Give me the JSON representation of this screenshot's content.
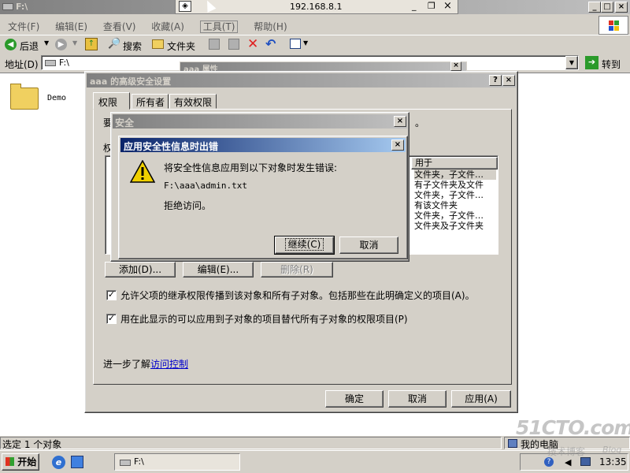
{
  "explorer": {
    "title": "F:\\",
    "menu": [
      "文件(F)",
      "编辑(E)",
      "查看(V)",
      "收藏(A)",
      "工具(T)",
      "帮助(H)"
    ],
    "toolbar": {
      "back": "后退",
      "search": "搜索",
      "folders": "文件夹"
    },
    "address_label": "地址(D)",
    "address_value": "F:\\",
    "go": "转到",
    "folder_item": "Demo",
    "status_left": "选定 1 个对象",
    "status_right": "我的电脑"
  },
  "remote_bar": {
    "host": "192.168.8.1"
  },
  "props_window": {
    "title": "aaa 属性"
  },
  "advanced": {
    "title": "aaa 的高级安全设置",
    "tabs": [
      "权限",
      "所有者",
      "有效权限"
    ],
    "intro_partial": "要",
    "entries_partial": "权",
    "apply_to_header": "用于",
    "apply_to_rows": [
      "文件夹，子文件…",
      "有子文件夹及文件",
      "文件夹，子文件…",
      "有该文件夹",
      "文件夹，子文件…",
      "文件夹及子文件夹"
    ],
    "add": "添加(D)...",
    "edit": "编辑(E)...",
    "remove": "删除(R)",
    "inherit_text": "允许父项的继承权限传播到该对象和所有子对象。包括那些在此明确定义的项目(A)。",
    "replace_text": "用在此显示的可以应用到子对象的项目替代所有子对象的权限项目(P)",
    "learn_prefix": "进一步了解",
    "learn_link": "访问控制",
    "ok": "确定",
    "cancel": "取消",
    "apply": "应用(A)"
  },
  "security": {
    "title": "安全"
  },
  "error": {
    "title": "应用安全性信息时出错",
    "line1": "将安全性信息应用到以下对象时发生错误:",
    "path": "F:\\aaa\\admin.txt",
    "reason": "拒绝访问。",
    "continue": "继续(C)",
    "cancel": "取消"
  },
  "taskbar": {
    "start": "开始",
    "task": "F:\\",
    "clock": "13:35"
  },
  "watermark": {
    "site": "51CTO.com",
    "sub": "技术博客",
    "blog": "Blog"
  }
}
